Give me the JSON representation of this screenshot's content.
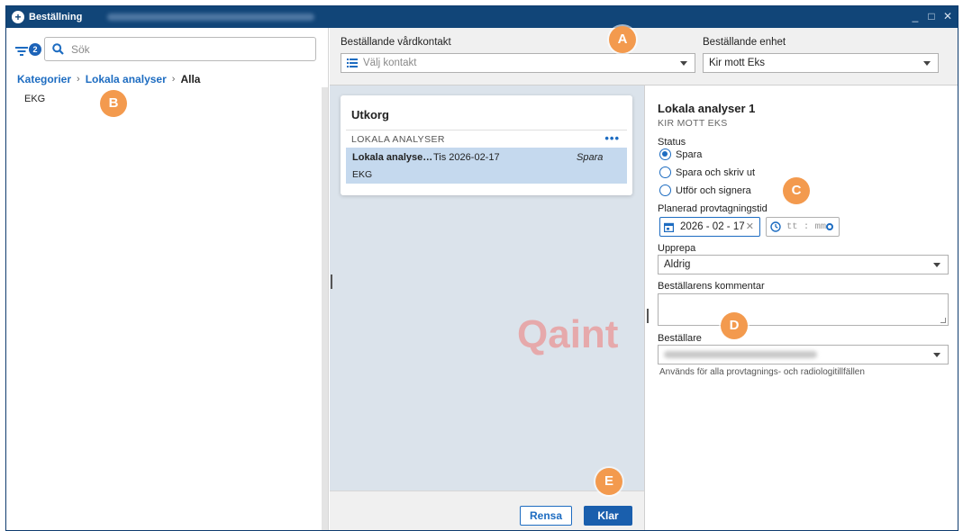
{
  "window": {
    "title": "Beställning",
    "icon": "plus-circle-icon",
    "controls": [
      "minimize-icon",
      "maximize-icon",
      "close-icon"
    ]
  },
  "left": {
    "filter_badge": "2",
    "search_placeholder": "Sök",
    "breadcrumb": {
      "item1": "Kategorier",
      "item2": "Lokala analyser",
      "current": "Alla",
      "separator": "›"
    },
    "items": [
      "EKG"
    ]
  },
  "topform": {
    "contact_label": "Beställande vårdkontakt",
    "contact_placeholder": "Välj kontakt",
    "unit_label": "Beställande enhet",
    "unit_value": "Kir mott Eks"
  },
  "utkorg": {
    "heading": "Utkorg",
    "group_label": "LOKALA ANALYSER",
    "more": "•••",
    "row": {
      "name": "Lokala analyse…",
      "date": "Tis 2026-02-17",
      "status": "Spara",
      "sub": "EKG"
    }
  },
  "watermark": "Qaint",
  "buttons": {
    "rensa": "Rensa",
    "klar": "Klar"
  },
  "detail": {
    "title": "Lokala analyser 1",
    "subtitle": "KIR MOTT EKS",
    "status_label": "Status",
    "status_options": [
      "Spara",
      "Spara och skriv ut",
      "Utför och signera"
    ],
    "status_selected": "Spara",
    "planned_label": "Planerad provtagningstid",
    "date_value": "2026 - 02 - 17",
    "time_placeholder": "tt : mm",
    "repeat_label": "Upprepa",
    "repeat_value": "Aldrig",
    "comment_label": "Beställarens kommentar",
    "orderer_label": "Beställare",
    "helper_text": "Används för alla provtagnings- och radiologitillfällen"
  },
  "markers": [
    "A",
    "B",
    "C",
    "D",
    "E"
  ],
  "colors": {
    "titlebar": "#114578",
    "accent": "#1d6cc1",
    "marker": "#f39a4e",
    "watermark": "#e8a0a0"
  }
}
